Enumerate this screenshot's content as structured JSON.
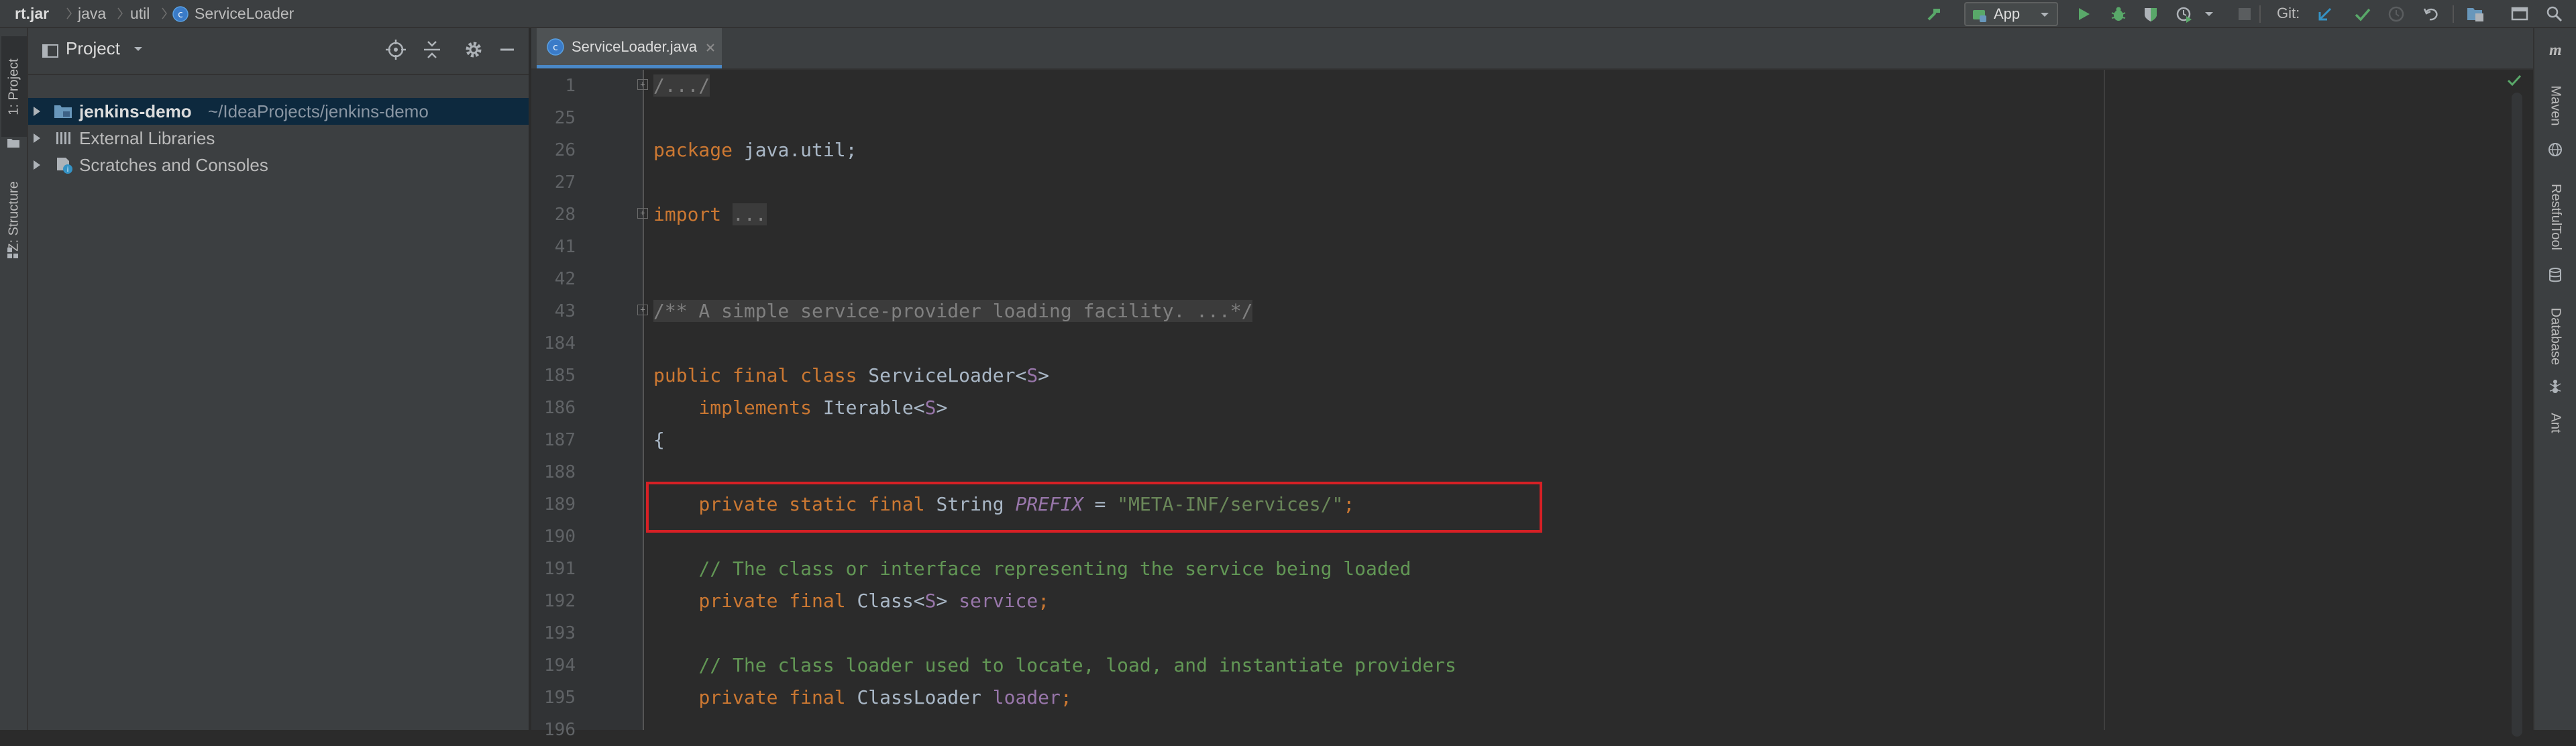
{
  "breadcrumb": {
    "items": [
      "rt.jar",
      "java",
      "util",
      "ServiceLoader"
    ]
  },
  "toolbar": {
    "run_config": "App",
    "git_label": "Git:"
  },
  "left_strip": {
    "tabs": [
      "1: Project",
      "Z: Structure"
    ]
  },
  "project_panel": {
    "title": "Project",
    "tree": [
      {
        "name": "jenkins-demo",
        "path": "~/IdeaProjects/jenkins-demo",
        "selected": true
      },
      {
        "name": "External Libraries"
      },
      {
        "name": "Scratches and Consoles"
      }
    ]
  },
  "editor": {
    "active_tab": "ServiceLoader.java",
    "lines": [
      {
        "num": "1"
      },
      {
        "num": "25"
      },
      {
        "num": "26"
      },
      {
        "num": "27"
      },
      {
        "num": "28"
      },
      {
        "num": "41"
      },
      {
        "num": "42"
      },
      {
        "num": "43"
      },
      {
        "num": "184"
      },
      {
        "num": "185"
      },
      {
        "num": "186"
      },
      {
        "num": "187"
      },
      {
        "num": "188"
      },
      {
        "num": "189"
      },
      {
        "num": "190"
      },
      {
        "num": "191"
      },
      {
        "num": "192"
      },
      {
        "num": "193"
      },
      {
        "num": "194"
      },
      {
        "num": "195"
      },
      {
        "num": "196"
      }
    ],
    "tokens": {
      "l1": "/.../",
      "l26_kw": "package",
      "l26_rest": " java.util;",
      "l28_kw": "import",
      "l28_rest": "...",
      "l43": "/** A simple service-provider loading facility. ...*/",
      "l185_kw": "public final class",
      "l185_name": " ServiceLoader<",
      "l185_type": "S",
      "l185_end": ">",
      "l186_kw": "implements",
      "l186_name": " Iterable<",
      "l186_type": "S",
      "l186_end": ">",
      "l187": "{",
      "l189_kw": "private static final",
      "l189_type": " String ",
      "l189_field": "PREFIX",
      "l189_eq": " = ",
      "l189_str": "\"META-INF/services/\"",
      "l189_semi": ";",
      "l191": "// The class or interface representing the service being loaded",
      "l192_kw": "private final",
      "l192_type": " Class<",
      "l192_s": "S",
      "l192_end": "> ",
      "l192_field": "service",
      "l192_semi": ";",
      "l194": "// The class loader used to locate, load, and instantiate providers",
      "l195_kw": "private final",
      "l195_type": " ClassLoader ",
      "l195_field": "loader",
      "l195_semi": ";"
    }
  },
  "right_strip": {
    "tabs": [
      "Maven",
      "RestfulTool",
      "Database",
      "Ant"
    ]
  },
  "colors": {
    "keyword": "#cc7832",
    "comment": "#629755",
    "field": "#9876aa",
    "string": "#6a8759",
    "highlight_box": "#d62025",
    "selection": "#0d293e"
  }
}
